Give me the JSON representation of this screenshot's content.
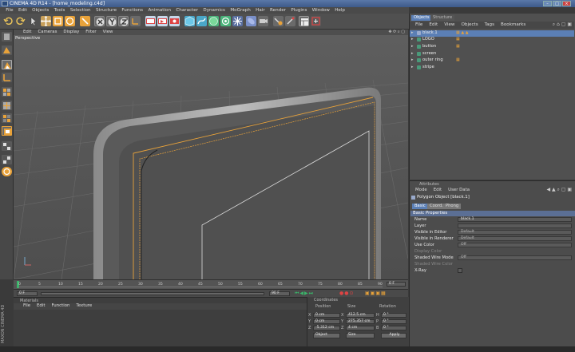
{
  "window": {
    "title": "CINEMA 4D R14 - [home_modeling.c4d]"
  },
  "menubar": [
    "File",
    "Edit",
    "Objects",
    "Tools",
    "Selection",
    "Structure",
    "Functions",
    "Animation",
    "Character",
    "Dynamics",
    "MoGraph",
    "Hair",
    "Render",
    "Plugins",
    "Window",
    "Help"
  ],
  "viewport": {
    "menu": [
      "Edit",
      "Cameras",
      "Display",
      "Filter",
      "View"
    ],
    "label": "Perspective"
  },
  "timeline": {
    "ticks": [
      "0",
      "5",
      "10",
      "15",
      "20",
      "25",
      "30",
      "35",
      "40",
      "45",
      "50",
      "55",
      "60",
      "65",
      "70",
      "75",
      "80",
      "85",
      "90"
    ],
    "frame_end": "0 F",
    "current_start": "0 F",
    "current_end": "90 F"
  },
  "materials": {
    "title": "Materials",
    "menu": [
      "File",
      "Edit",
      "Function",
      "Texture"
    ]
  },
  "coordinates": {
    "title": "Coordinates",
    "headers": [
      "Position",
      "Size",
      "Rotation"
    ],
    "rows": [
      {
        "axis": "X",
        "pos": "0 cm",
        "size": "412.5 cm",
        "raxis": "H",
        "rot": "0 °"
      },
      {
        "axis": "Y",
        "pos": "0 cm",
        "size": "275.357 cm",
        "raxis": "P",
        "rot": "0 °"
      },
      {
        "axis": "Z",
        "pos": "-5.312 cm",
        "size": "4 cm",
        "raxis": "B",
        "rot": "0 °"
      }
    ],
    "mode_select": "Object",
    "size_select": "Size",
    "apply_label": "Apply"
  },
  "object_manager": {
    "tabs": [
      "Objects",
      "Structure"
    ],
    "menu": [
      "File",
      "Edit",
      "View",
      "Objects",
      "Tags",
      "Bookmarks"
    ],
    "objects": [
      {
        "name": "black.1",
        "selected": true
      },
      {
        "name": "LOGO",
        "selected": false
      },
      {
        "name": "button",
        "selected": false
      },
      {
        "name": "screen",
        "selected": false
      },
      {
        "name": "outer ring",
        "selected": false
      },
      {
        "name": "stripe",
        "selected": false
      }
    ]
  },
  "attributes": {
    "title": "Attributes",
    "menu": [
      "Mode",
      "Edit",
      "User Data"
    ],
    "object_title": "Polygon Object [black.1]",
    "tabs": [
      "Basic",
      "Coord.",
      "Phong"
    ],
    "section": "Basic Properties",
    "rows": [
      {
        "label": "Name",
        "value": "black.1",
        "dim": false
      },
      {
        "label": "Layer",
        "value": "",
        "dim": false
      },
      {
        "label": "Visible in Editor",
        "value": "Default",
        "dim": false
      },
      {
        "label": "Visible in Renderer",
        "value": "Default",
        "dim": false
      },
      {
        "label": "Use Color",
        "value": "Off",
        "dim": false
      },
      {
        "label": "Display Color",
        "value": "",
        "dim": true
      },
      {
        "label": "Shaded Wire Mode",
        "value": "Off",
        "dim": false
      },
      {
        "label": "Shaded Wire Color",
        "value": "",
        "dim": true
      },
      {
        "label": "X-Ray",
        "value": "",
        "dim": false
      }
    ]
  },
  "brand": {
    "side_text": "MAXON CINEMA 4D"
  },
  "colors": {
    "accent": "#e8a23a",
    "selection": "#f0a020",
    "panel": "#505050",
    "highlight": "#5b7fb5"
  }
}
